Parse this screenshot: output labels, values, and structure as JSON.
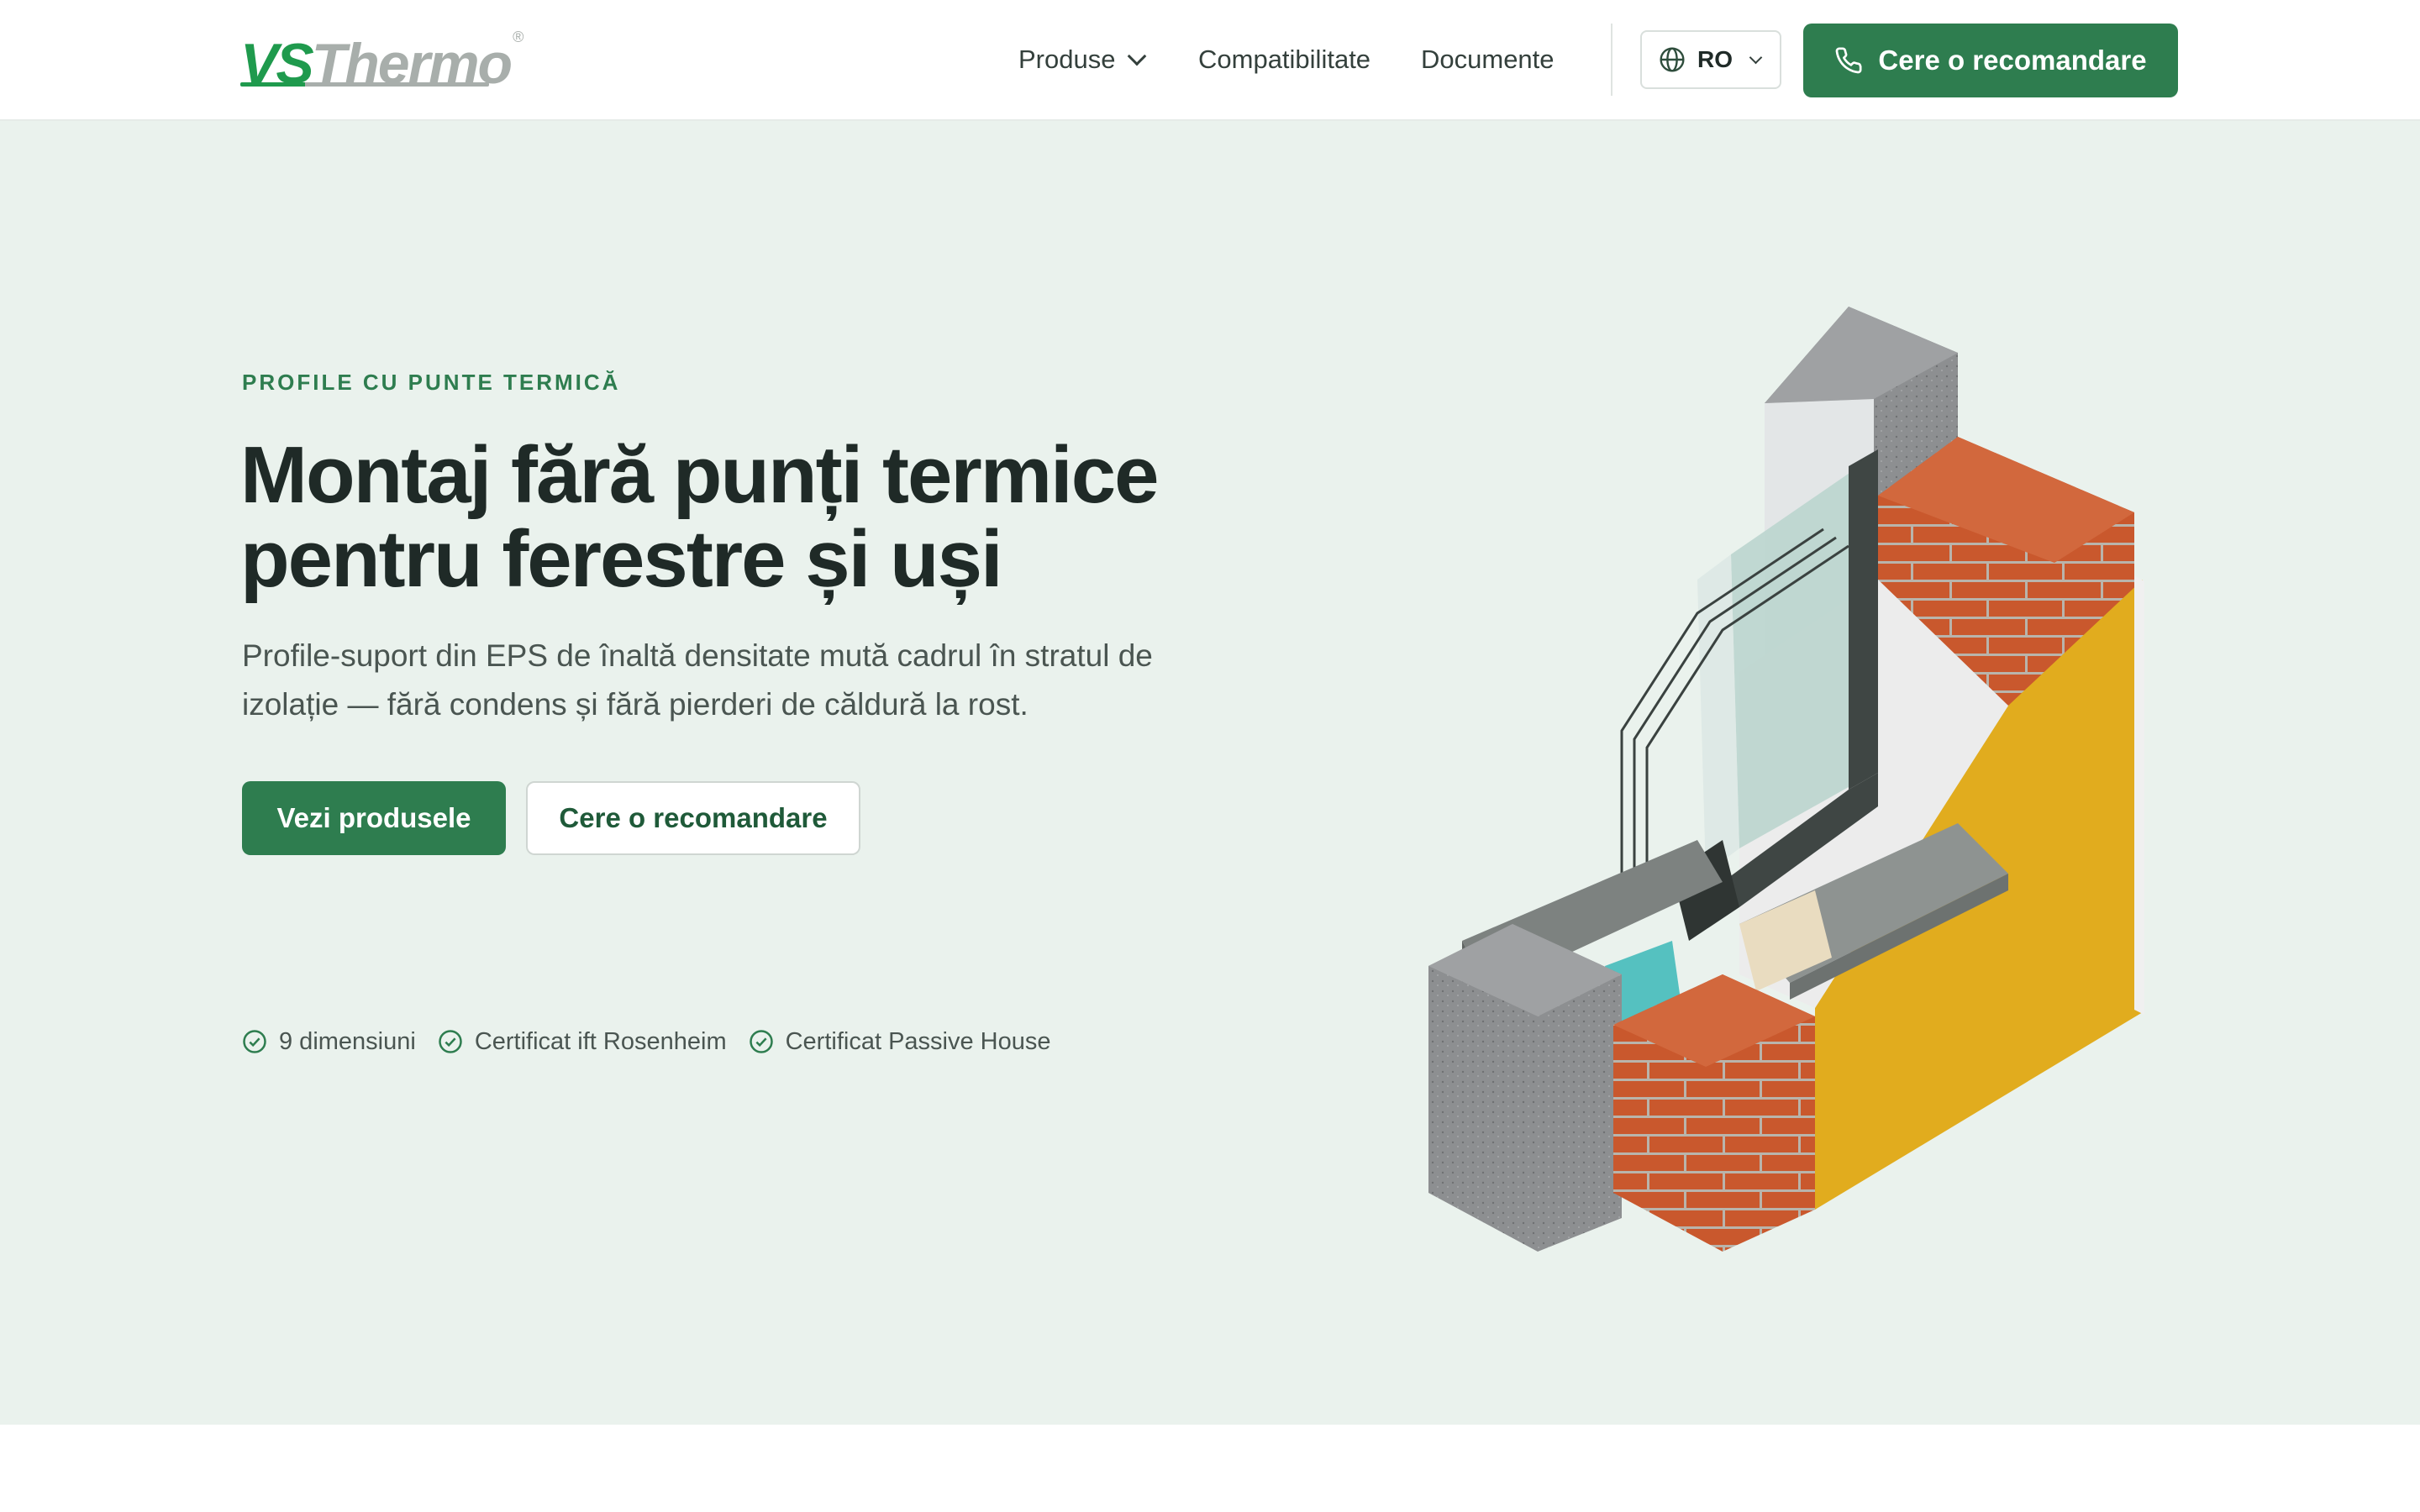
{
  "header": {
    "logo": {
      "part1": "VS",
      "part2": "Thermo",
      "reg": "®"
    },
    "nav": [
      {
        "label": "Produse",
        "has_dropdown": true
      },
      {
        "label": "Compatibilitate"
      },
      {
        "label": "Documente"
      }
    ],
    "language": {
      "value": "RO",
      "icon": "globe-icon"
    },
    "cta": {
      "label": "Cere o recomandare",
      "icon": "phone-icon"
    }
  },
  "hero": {
    "eyebrow": "PROFILE CU PUNTE TERMICĂ",
    "title_line1": "Montaj fără punți termice",
    "title_line2": "pentru ferestre și uși",
    "subtitle": "Profile-suport din EPS de înaltă densitate mută cadrul în stratul de izolație — fără condens și fără pierderi de căldură la rost.",
    "primary_button": "Vezi produsele",
    "secondary_button": "Cere o recomandare",
    "badges": [
      {
        "label": "9 dimensiuni",
        "icon": "check-circle-icon"
      },
      {
        "label": "Certificat ift Rosenheim",
        "icon": "check-circle-icon"
      },
      {
        "label": "Certificat Passive House",
        "icon": "check-circle-icon"
      }
    ],
    "illustration": "window-installation-cross-section"
  },
  "colors": {
    "accent": "#2e7d4f",
    "hero_background": "#eaf2ed",
    "logo_green": "#1f9a4d",
    "logo_grey": "#a8aeab"
  }
}
